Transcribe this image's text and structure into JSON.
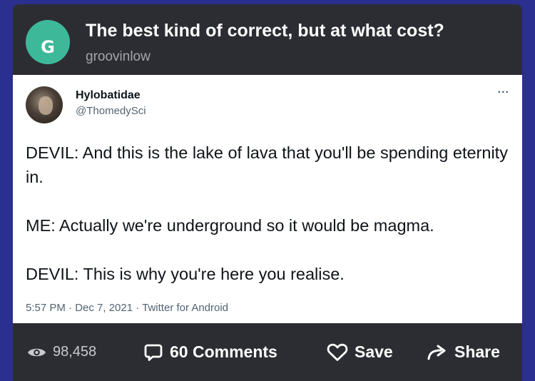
{
  "post": {
    "title": "The best kind of correct, but at what cost?",
    "author": "groovinlow",
    "avatar_letter": "G",
    "avatar_color": "#3db99a"
  },
  "tweet": {
    "name": "Hylobatidae",
    "handle": "@ThomedySci",
    "more": "...",
    "lines": [
      "DEVIL: And this is the lake of lava that you'll be spending eternity in.",
      "ME: Actually we're underground so it would be magma.",
      "DEVIL: This is why you're here you realise."
    ],
    "meta": "5:57 PM · Dec 7, 2021 · Twitter for Android"
  },
  "actions": {
    "views": "98,458",
    "comments": "60 Comments",
    "save": "Save",
    "share": "Share"
  },
  "icons": {
    "views": "eye-icon",
    "comments": "comment-bubble-icon",
    "save": "heart-icon",
    "share": "share-arrow-icon"
  },
  "colors": {
    "page_background": "#2b2f8f",
    "card_background": "#2c2d33",
    "avatar_accent": "#3db99a"
  }
}
